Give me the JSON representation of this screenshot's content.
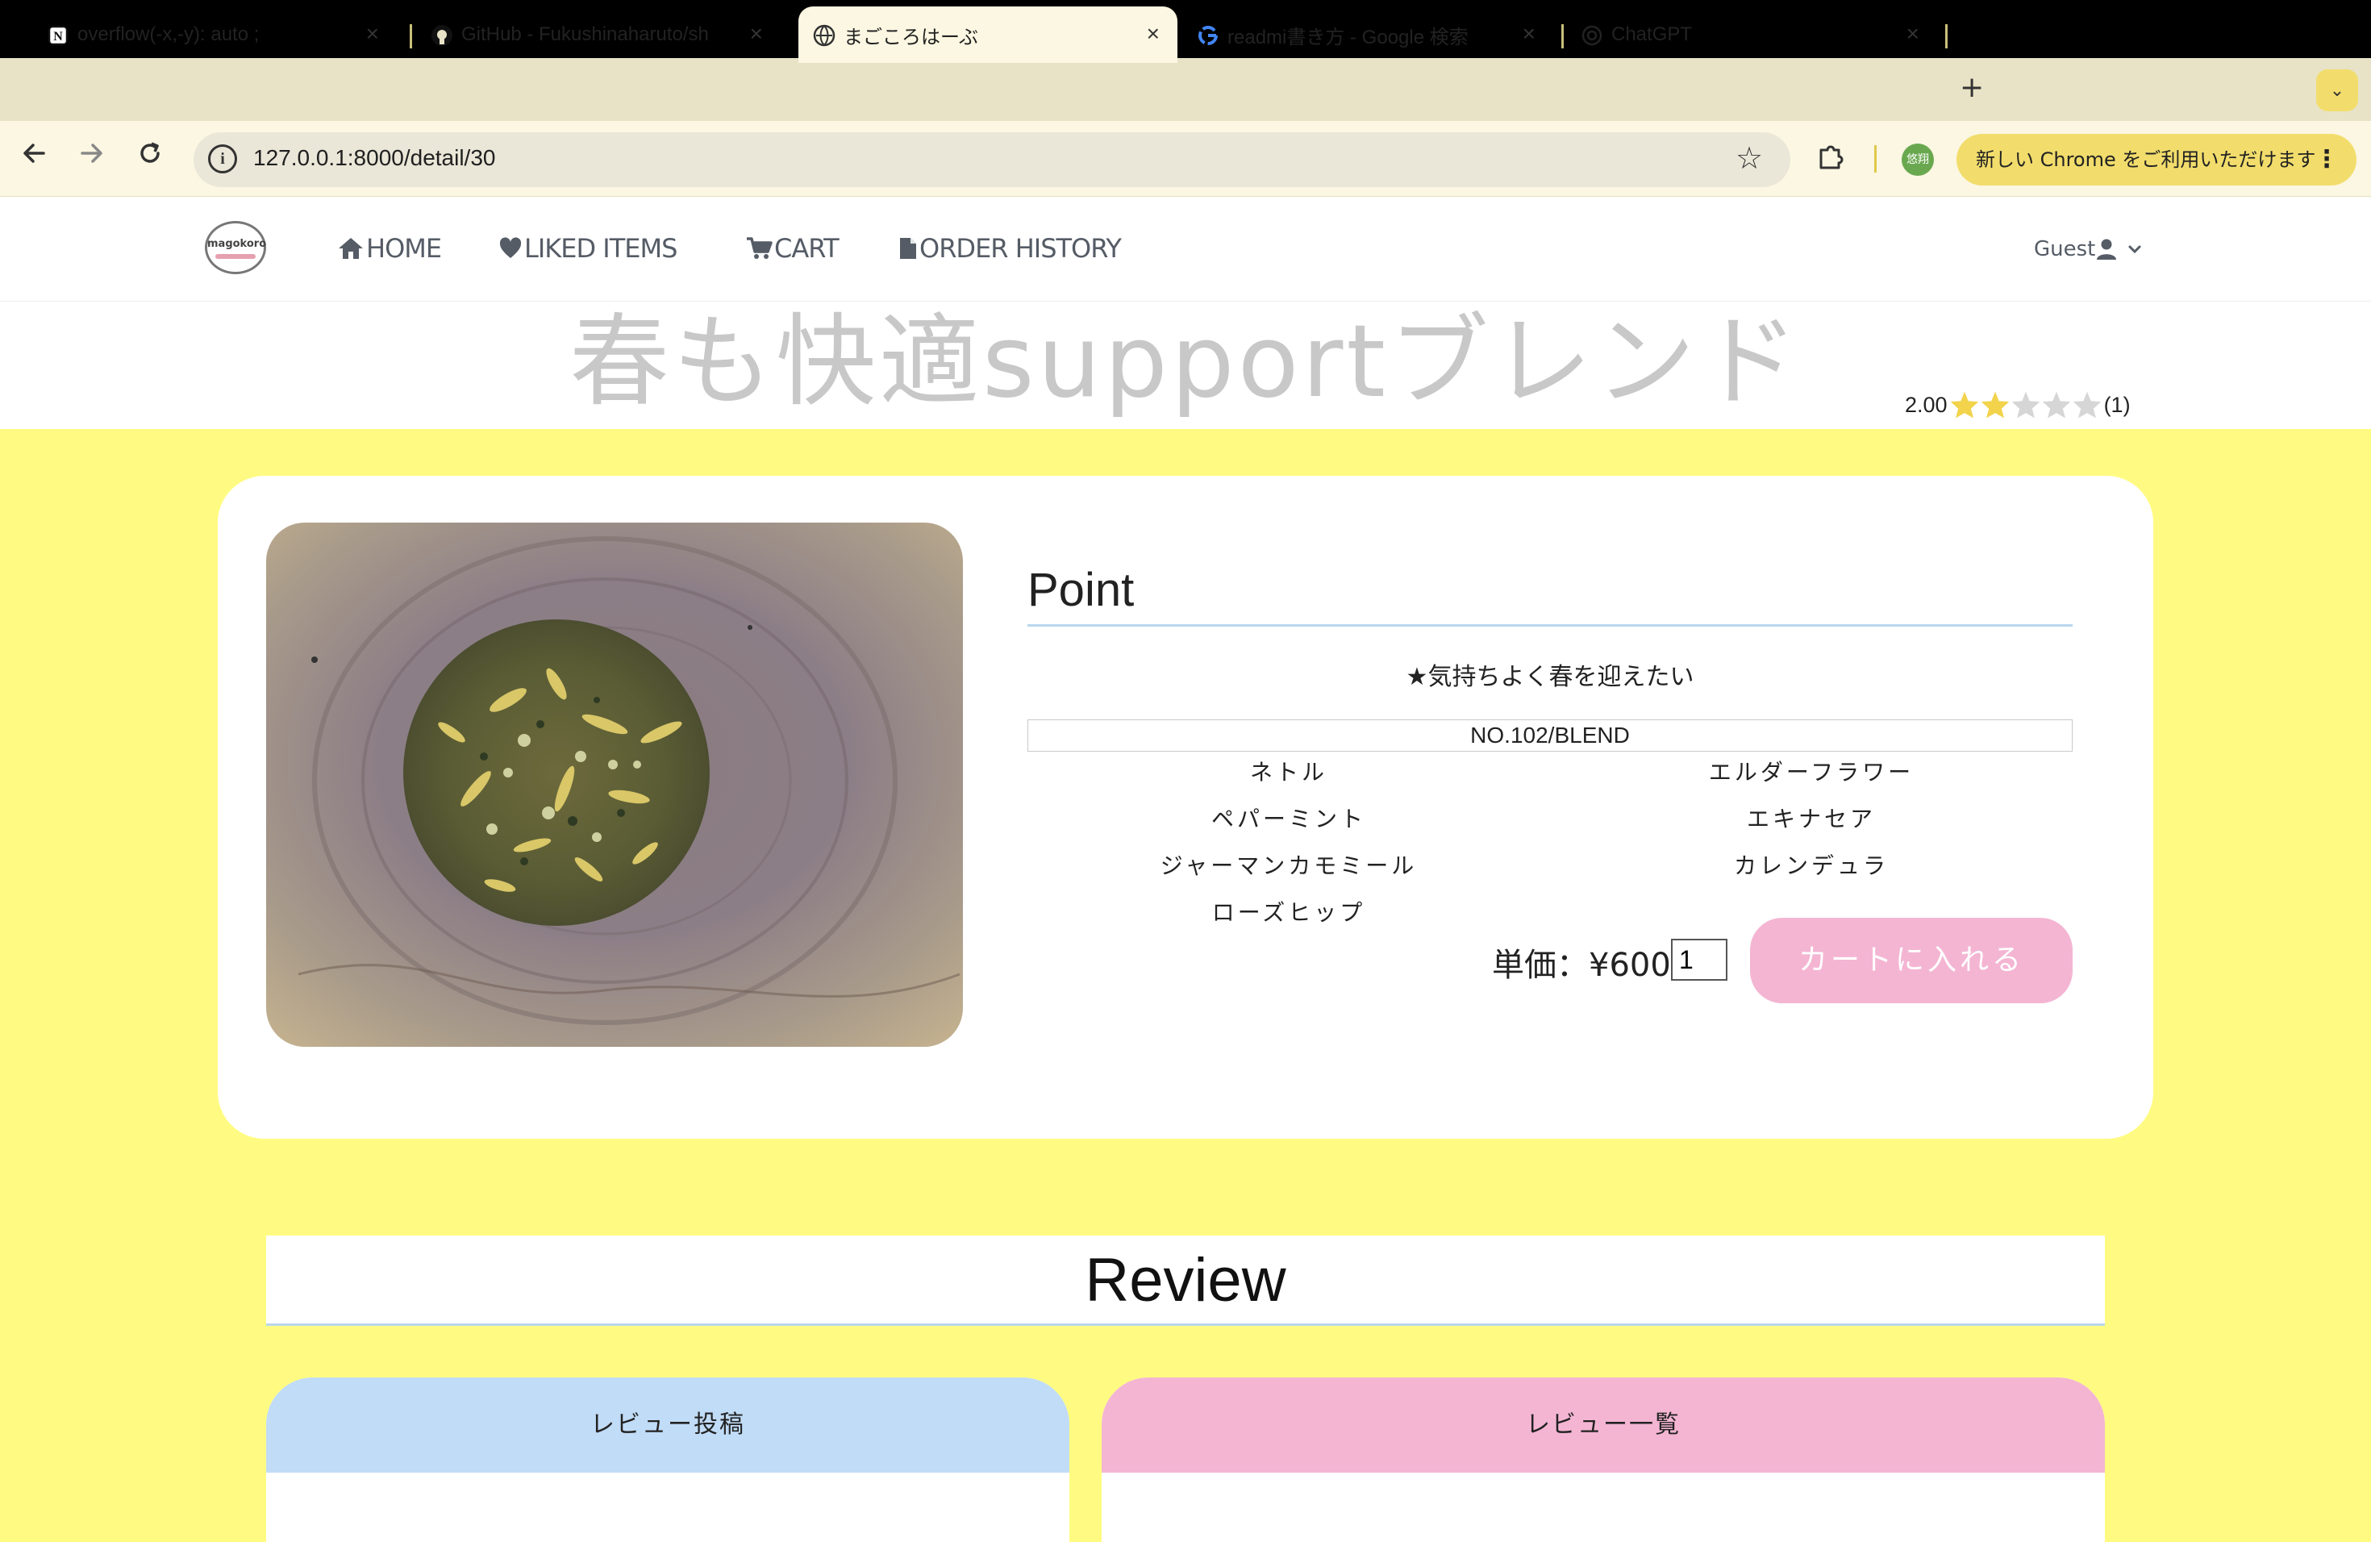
{
  "browser": {
    "tabs": [
      {
        "title": "overflow(-x,-y): auto ;",
        "icon": "notion-icon",
        "active": false
      },
      {
        "title": "GitHub - Fukushinaharuto/sh",
        "icon": "github-icon",
        "active": false
      },
      {
        "title": "まごころはーぶ",
        "icon": "globe-icon",
        "active": true
      },
      {
        "title": "readmi書き方 - Google 検索",
        "icon": "google-icon",
        "active": false
      },
      {
        "title": "ChatGPT",
        "icon": "chatgpt-icon",
        "active": false
      }
    ],
    "url": "127.0.0.1:8000/detail/30",
    "profile_label": "悠翔",
    "update_chip": "新しい Chrome をご利用いただけます"
  },
  "nav": {
    "logo_text": "magokoro",
    "links": [
      {
        "label": "HOME",
        "icon": "home-icon"
      },
      {
        "label": "LIKED ITEMS",
        "icon": "heart-icon"
      },
      {
        "label": "CART",
        "icon": "cart-icon"
      },
      {
        "label": "ORDER HISTORY",
        "icon": "document-icon"
      }
    ],
    "user_label": "Guest"
  },
  "product": {
    "title": "春も快適supportブレンド",
    "rating_value": "2.00",
    "rating_stars": 2,
    "rating_max": 5,
    "rating_count": "(1)",
    "point_heading": "Point",
    "point_text": "★気持ちよく春を迎えたい",
    "blend_code": "NO.102/BLEND",
    "herbs": [
      "ネトル",
      "エルダーフラワー",
      "ペパーミント",
      "エキナセア",
      "ジャーマンカモミール",
      "カレンデュラ",
      "ローズヒップ"
    ],
    "price_label": "単価：¥600",
    "quantity": "1",
    "add_to_cart": "カートに入れる"
  },
  "review": {
    "heading": "Review",
    "post_tab": "レビュー投稿",
    "list_tab": "レビュー一覧"
  },
  "colors": {
    "page_bg": "#fffb82",
    "cart_button": "#f4b5d3",
    "post_tab": "#c1dcf7",
    "list_tab": "#f4b5d3",
    "star_filled": "#f2d34b",
    "star_empty": "#d6d6d6"
  }
}
